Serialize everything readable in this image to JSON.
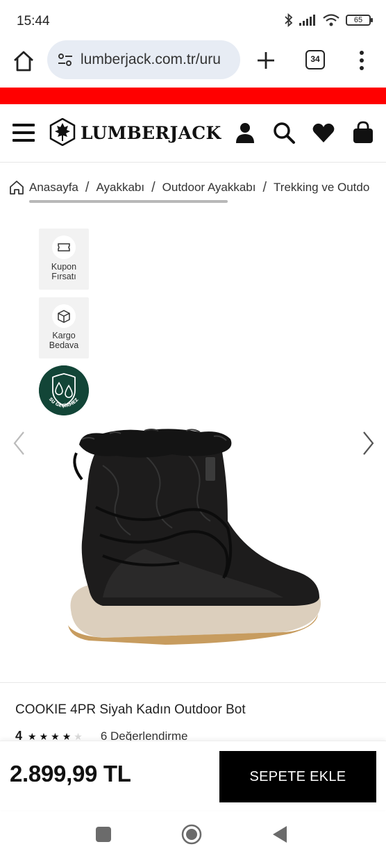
{
  "status_bar": {
    "time": "15:44",
    "battery": "65",
    "icons": [
      "bluetooth-icon",
      "signal-icon",
      "wifi-icon",
      "battery-icon"
    ]
  },
  "browser": {
    "url": "lumberjack.com.tr/uru",
    "tab_count": "34"
  },
  "header": {
    "logo_text": "LUMBERJACK"
  },
  "breadcrumb": {
    "items": [
      "Anasayfa",
      "Ayakkabı",
      "Outdoor Ayakkabı",
      "Trekking ve Outdo"
    ],
    "separator": "/"
  },
  "badges": [
    {
      "line1": "Kupon",
      "line2": "Fırsatı",
      "icon": "ticket-icon"
    },
    {
      "line1": "Kargo",
      "line2": "Bedava",
      "icon": "package-icon"
    }
  ],
  "waterproof_badge": {
    "label": "SU GEÇİRMEZ",
    "icon": "water-drops-icon"
  },
  "product": {
    "title": "COOKIE 4PR Siyah Kadın Outdoor Bot",
    "rating": "4",
    "stars_filled": 4,
    "stars_total": 5,
    "reviews": "6 Değerlendirme"
  },
  "buy_bar": {
    "price": "2.899,99 TL",
    "cart_label": "SEPETE EKLE"
  },
  "colors": {
    "banner": "#ff0000",
    "badge_green": "#124537",
    "url_bg": "#e7ecf4",
    "button": "#000000"
  }
}
